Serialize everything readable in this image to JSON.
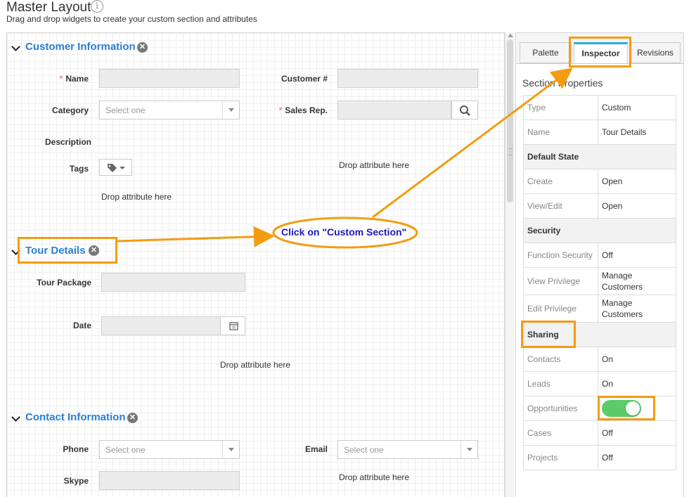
{
  "header": {
    "title": "Master Layout",
    "info_icon": "i",
    "subtitle": "Drag and drop widgets to create your custom section and attributes"
  },
  "sections": {
    "customer": {
      "title": "Customer Information",
      "name_label": "Name",
      "customer_no_label": "Customer #",
      "category_label": "Category",
      "category_placeholder": "Select one",
      "sales_rep_label": "Sales Rep.",
      "description_label": "Description",
      "tags_label": "Tags",
      "drop_right": "Drop attribute here",
      "drop_left": "Drop attribute here"
    },
    "tour": {
      "title": "Tour Details",
      "tour_package_label": "Tour Package",
      "date_label": "Date",
      "drop": "Drop attribute here"
    },
    "contact": {
      "title": "Contact Information",
      "phone_label": "Phone",
      "phone_placeholder": "Select one",
      "email_label": "Email",
      "email_placeholder": "Select one",
      "skype_label": "Skype",
      "drop": "Drop attribute here"
    }
  },
  "required_marker": "*",
  "callout": {
    "text": "Click on \"Custom Section\""
  },
  "panel": {
    "tabs": [
      "Palette",
      "Inspector",
      "Revisions"
    ],
    "active_tab": "Inspector",
    "heading": "Section Properties",
    "rows": [
      {
        "k": "Type",
        "v": "Custom"
      },
      {
        "k": "Name",
        "v": "Tour Details"
      },
      {
        "header": "Default State"
      },
      {
        "k": "Create",
        "v": "Open"
      },
      {
        "k": "View/Edit",
        "v": "Open"
      },
      {
        "header": "Security"
      },
      {
        "k": "Function Security",
        "v": "Off"
      },
      {
        "k": "View Privilege",
        "v": "Manage Customers"
      },
      {
        "k": "Edit Privilege",
        "v": "Manage Customers"
      },
      {
        "header": "Sharing"
      },
      {
        "k": "Contacts",
        "v": "On"
      },
      {
        "k": "Leads",
        "v": "On"
      },
      {
        "k": "Opportunities",
        "toggle": true,
        "toggle_on": true
      },
      {
        "k": "Cases",
        "v": "Off"
      },
      {
        "k": "Projects",
        "v": "Off"
      }
    ]
  },
  "colors": {
    "accent": "#2d7fd3",
    "annotation": "#f39c12",
    "toggle_on": "#5ccb6a",
    "active_tab_bar": "#29a9e0"
  },
  "icons": [
    "info-icon",
    "chevron-down-icon",
    "close-icon",
    "search-icon",
    "calendar-icon",
    "tag-icon",
    "caret-down-icon"
  ]
}
